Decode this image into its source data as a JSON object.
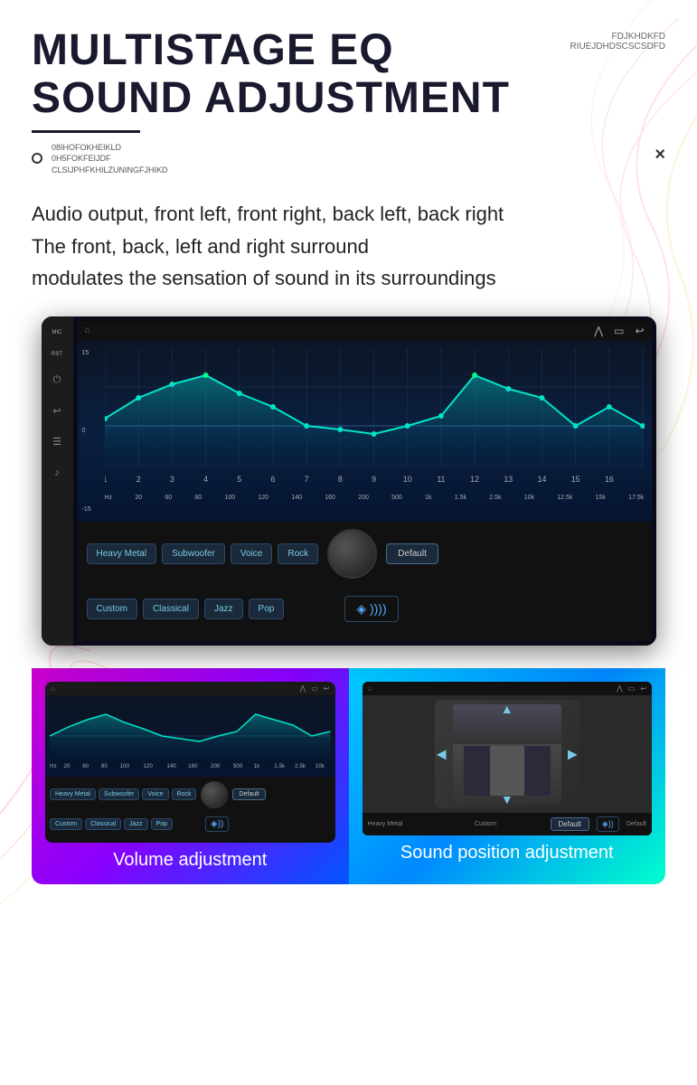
{
  "header": {
    "title_line1": "MULTISTAGE EQ",
    "title_line2": "SOUND ADJUSTMENT",
    "top_right_text1": "FDJKHDKFD",
    "top_right_text2": "RIUEJDHDSCSCSDFD",
    "subtitle_lines": [
      "08IHOFOKHEIKLD",
      "0H5FOKFEIJDF",
      "CLSIJPHFKHILZUNINGFJHIKD"
    ]
  },
  "close_button": "×",
  "description": "Audio output, front left, front right, back left, back right\nThe front, back, left and right surround\nmodulates the sensation of sound in its surroundings",
  "device": {
    "topbar": {
      "home_icon": "⌂",
      "chevron_up": "⋀",
      "window_icon": "▭",
      "back_icon": "↩",
      "mic_label": "MIC",
      "rst_label": "RST"
    },
    "eq_y_labels": [
      "15",
      "",
      "0",
      "",
      "-15"
    ],
    "eq_x_labels": [
      "Hz",
      "20",
      "60",
      "80",
      "100",
      "120",
      "140",
      "160",
      "200",
      "500",
      "1k",
      "1.5k",
      "2.5k",
      "10k",
      "12.5k",
      "15k",
      "17.5k"
    ],
    "freq_numbers": [
      "1",
      "2",
      "3",
      "4",
      "5",
      "6",
      "7",
      "8",
      "9",
      "10",
      "11",
      "12",
      "13",
      "14",
      "15",
      "16"
    ],
    "presets_row1": [
      "Heavy Metal",
      "Subwoofer",
      "Voice",
      "Rock",
      "Default"
    ],
    "presets_row2": [
      "Custom",
      "Classical",
      "Jazz",
      "Pop",
      "sound-icon"
    ]
  },
  "bottom_panels": {
    "volume": {
      "title": "Volume adjustment",
      "mini_presets_row1": [
        "Heavy Metal",
        "Subwoofer",
        "Voice",
        "Rock",
        "Default"
      ],
      "mini_presets_row2": [
        "Custom",
        "Classical",
        "Jazz",
        "Pop"
      ]
    },
    "sound_position": {
      "title": "Sound position adjustment",
      "bottom_label_left": "Heavy Metal",
      "bottom_label_right": "Default",
      "bottom_label_left2": "Custom",
      "bottom_btn": "Default"
    }
  },
  "colors": {
    "title_color": "#1a1a2e",
    "accent_cyan": "#00e5ff",
    "accent_green": "#00ff88",
    "eq_line_color": "#00e5c8",
    "eq_fill_start": "rgba(0,180,180,0.5)",
    "eq_fill_end": "rgba(0,80,120,0.1)"
  }
}
